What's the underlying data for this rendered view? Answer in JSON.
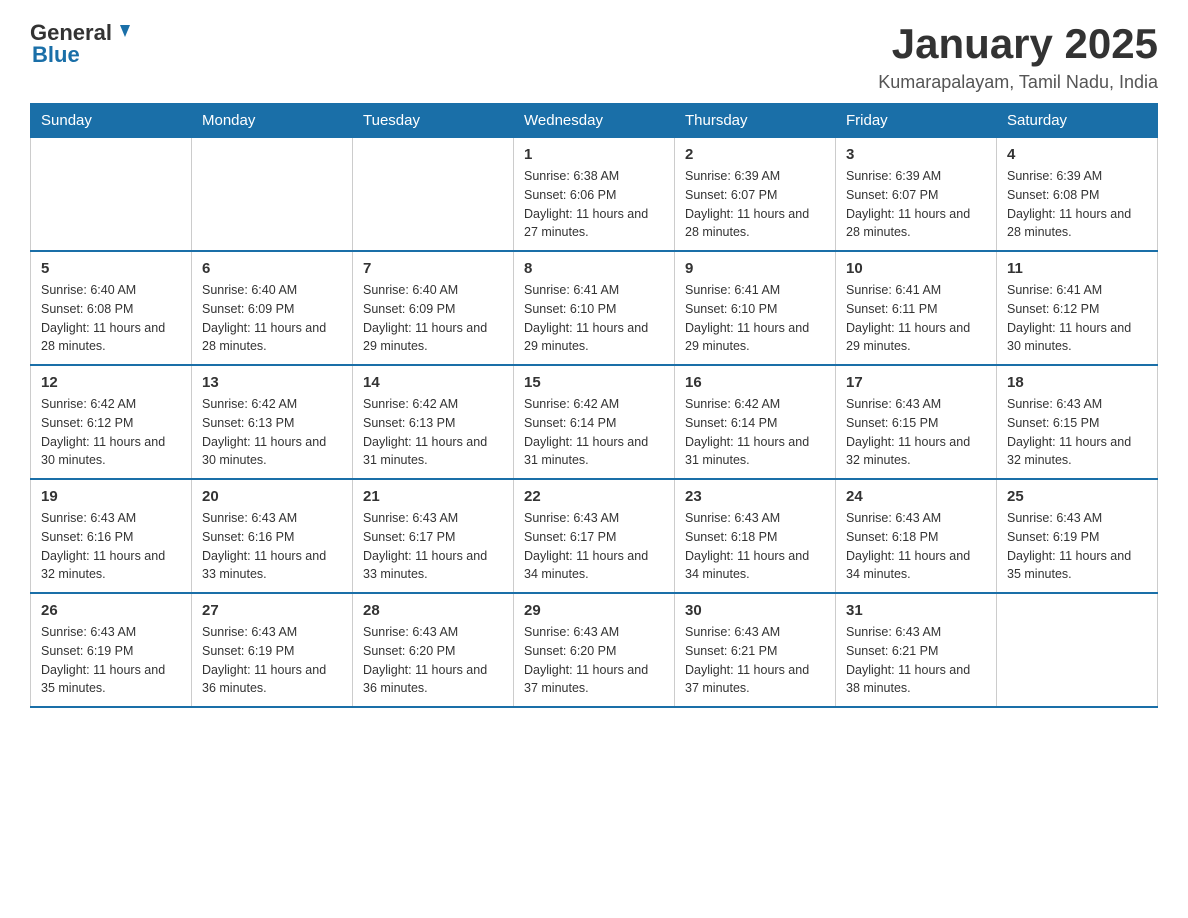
{
  "logo": {
    "text_general": "General",
    "text_blue": "Blue"
  },
  "header": {
    "title": "January 2025",
    "location": "Kumarapalayam, Tamil Nadu, India"
  },
  "days_of_week": [
    "Sunday",
    "Monday",
    "Tuesday",
    "Wednesday",
    "Thursday",
    "Friday",
    "Saturday"
  ],
  "weeks": [
    [
      {
        "day": "",
        "info": ""
      },
      {
        "day": "",
        "info": ""
      },
      {
        "day": "",
        "info": ""
      },
      {
        "day": "1",
        "info": "Sunrise: 6:38 AM\nSunset: 6:06 PM\nDaylight: 11 hours and 27 minutes."
      },
      {
        "day": "2",
        "info": "Sunrise: 6:39 AM\nSunset: 6:07 PM\nDaylight: 11 hours and 28 minutes."
      },
      {
        "day": "3",
        "info": "Sunrise: 6:39 AM\nSunset: 6:07 PM\nDaylight: 11 hours and 28 minutes."
      },
      {
        "day": "4",
        "info": "Sunrise: 6:39 AM\nSunset: 6:08 PM\nDaylight: 11 hours and 28 minutes."
      }
    ],
    [
      {
        "day": "5",
        "info": "Sunrise: 6:40 AM\nSunset: 6:08 PM\nDaylight: 11 hours and 28 minutes."
      },
      {
        "day": "6",
        "info": "Sunrise: 6:40 AM\nSunset: 6:09 PM\nDaylight: 11 hours and 28 minutes."
      },
      {
        "day": "7",
        "info": "Sunrise: 6:40 AM\nSunset: 6:09 PM\nDaylight: 11 hours and 29 minutes."
      },
      {
        "day": "8",
        "info": "Sunrise: 6:41 AM\nSunset: 6:10 PM\nDaylight: 11 hours and 29 minutes."
      },
      {
        "day": "9",
        "info": "Sunrise: 6:41 AM\nSunset: 6:10 PM\nDaylight: 11 hours and 29 minutes."
      },
      {
        "day": "10",
        "info": "Sunrise: 6:41 AM\nSunset: 6:11 PM\nDaylight: 11 hours and 29 minutes."
      },
      {
        "day": "11",
        "info": "Sunrise: 6:41 AM\nSunset: 6:12 PM\nDaylight: 11 hours and 30 minutes."
      }
    ],
    [
      {
        "day": "12",
        "info": "Sunrise: 6:42 AM\nSunset: 6:12 PM\nDaylight: 11 hours and 30 minutes."
      },
      {
        "day": "13",
        "info": "Sunrise: 6:42 AM\nSunset: 6:13 PM\nDaylight: 11 hours and 30 minutes."
      },
      {
        "day": "14",
        "info": "Sunrise: 6:42 AM\nSunset: 6:13 PM\nDaylight: 11 hours and 31 minutes."
      },
      {
        "day": "15",
        "info": "Sunrise: 6:42 AM\nSunset: 6:14 PM\nDaylight: 11 hours and 31 minutes."
      },
      {
        "day": "16",
        "info": "Sunrise: 6:42 AM\nSunset: 6:14 PM\nDaylight: 11 hours and 31 minutes."
      },
      {
        "day": "17",
        "info": "Sunrise: 6:43 AM\nSunset: 6:15 PM\nDaylight: 11 hours and 32 minutes."
      },
      {
        "day": "18",
        "info": "Sunrise: 6:43 AM\nSunset: 6:15 PM\nDaylight: 11 hours and 32 minutes."
      }
    ],
    [
      {
        "day": "19",
        "info": "Sunrise: 6:43 AM\nSunset: 6:16 PM\nDaylight: 11 hours and 32 minutes."
      },
      {
        "day": "20",
        "info": "Sunrise: 6:43 AM\nSunset: 6:16 PM\nDaylight: 11 hours and 33 minutes."
      },
      {
        "day": "21",
        "info": "Sunrise: 6:43 AM\nSunset: 6:17 PM\nDaylight: 11 hours and 33 minutes."
      },
      {
        "day": "22",
        "info": "Sunrise: 6:43 AM\nSunset: 6:17 PM\nDaylight: 11 hours and 34 minutes."
      },
      {
        "day": "23",
        "info": "Sunrise: 6:43 AM\nSunset: 6:18 PM\nDaylight: 11 hours and 34 minutes."
      },
      {
        "day": "24",
        "info": "Sunrise: 6:43 AM\nSunset: 6:18 PM\nDaylight: 11 hours and 34 minutes."
      },
      {
        "day": "25",
        "info": "Sunrise: 6:43 AM\nSunset: 6:19 PM\nDaylight: 11 hours and 35 minutes."
      }
    ],
    [
      {
        "day": "26",
        "info": "Sunrise: 6:43 AM\nSunset: 6:19 PM\nDaylight: 11 hours and 35 minutes."
      },
      {
        "day": "27",
        "info": "Sunrise: 6:43 AM\nSunset: 6:19 PM\nDaylight: 11 hours and 36 minutes."
      },
      {
        "day": "28",
        "info": "Sunrise: 6:43 AM\nSunset: 6:20 PM\nDaylight: 11 hours and 36 minutes."
      },
      {
        "day": "29",
        "info": "Sunrise: 6:43 AM\nSunset: 6:20 PM\nDaylight: 11 hours and 37 minutes."
      },
      {
        "day": "30",
        "info": "Sunrise: 6:43 AM\nSunset: 6:21 PM\nDaylight: 11 hours and 37 minutes."
      },
      {
        "day": "31",
        "info": "Sunrise: 6:43 AM\nSunset: 6:21 PM\nDaylight: 11 hours and 38 minutes."
      },
      {
        "day": "",
        "info": ""
      }
    ]
  ]
}
